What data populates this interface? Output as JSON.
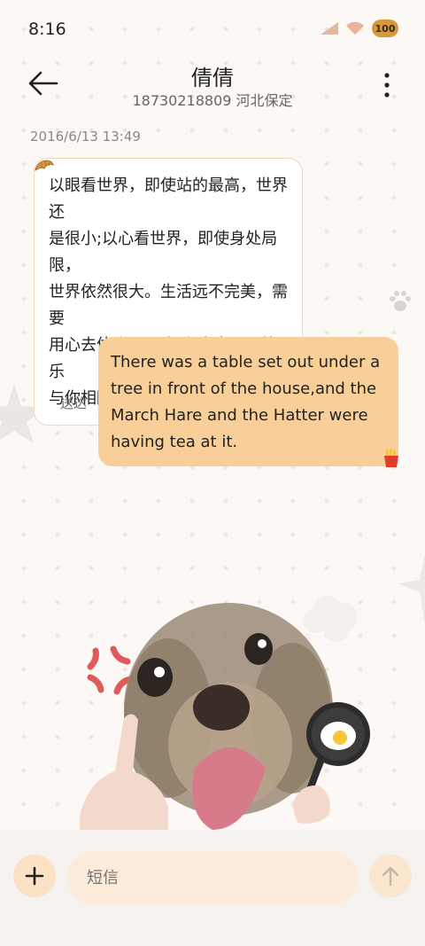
{
  "status": {
    "time": "8:16",
    "battery": "100"
  },
  "header": {
    "contact_name": "倩倩",
    "contact_detail": "18730218809 河北保定"
  },
  "messages": {
    "timestamp": "2016/6/13 13:49",
    "incoming": [
      "以眼看世界，即使站的最高，世界还",
      "是很小;以心看世界，即使身处局限，",
      "世界依然很大。生活远不完美，需要",
      "用心去体会;无需拥有太多，愿快乐",
      "与你相随。"
    ],
    "outgoing": [
      "There was a table set out under a",
      "tree in front of the house,and the",
      "March Hare and the Hatter were",
      "having tea at it."
    ],
    "outgoing_status": "送达"
  },
  "composer": {
    "placeholder": "短信"
  },
  "colors": {
    "accent": "#f8cf98",
    "bubble_border": "#f0d9b5",
    "composer_bg": "#fcebd8"
  },
  "icons": [
    "back-arrow-icon",
    "more-icon",
    "signal-icon",
    "wifi-icon",
    "battery-icon",
    "croissant-icon",
    "fries-icon",
    "paw-icon",
    "plus-icon",
    "send-arrow-icon"
  ]
}
